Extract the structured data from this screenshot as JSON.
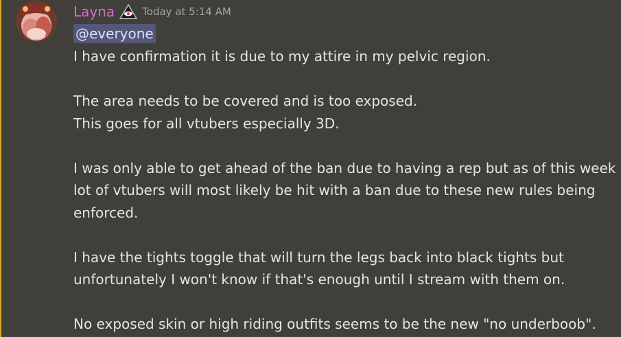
{
  "message": {
    "author": "Layna",
    "timestamp": "Today at 5:14 AM",
    "mention": "@everyone",
    "lines": [
      "I have confirmation it is due to my attire in my pelvic region.",
      "",
      "The area needs to be covered and is too exposed.",
      "This goes for all vtubers especially 3D.",
      "",
      "I was only able to get ahead of the ban due to having a rep but as of this week a",
      "lot of vtubers will most likely be hit with a ban due to these new rules being",
      "enforced.",
      "",
      "I have the tights toggle that will turn the legs back into black tights but",
      "unfortunately I won't know if that's enough until I stream with them on.",
      "",
      "No exposed skin or high riding outfits seems to be the new \"no underboob\"."
    ]
  },
  "icons": {
    "avatar": "avatar-image",
    "role_badge": "eye-triangle-icon"
  },
  "colors": {
    "background": "#413f39",
    "highlight_bar": "#e0a92a",
    "username": "#d96ad0",
    "mention_bg": "#54567a",
    "text": "#e6e5e1",
    "timestamp": "#a6a5a1"
  }
}
